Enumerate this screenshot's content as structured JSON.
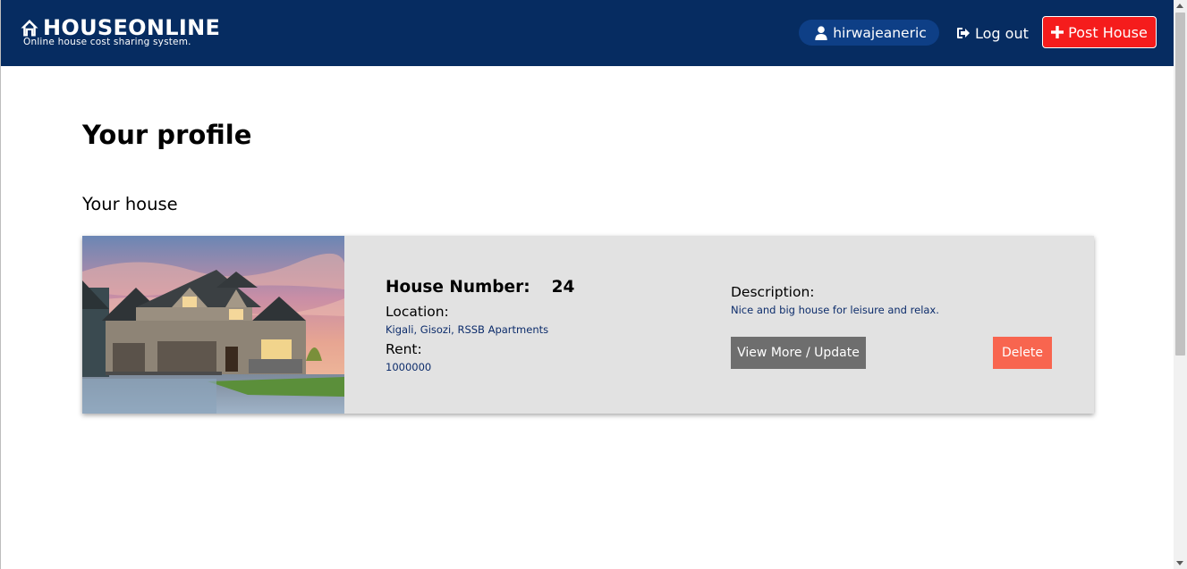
{
  "header": {
    "brand_name": "HOUSEONLINE",
    "brand_tagline": "Online house cost sharing system.",
    "username": "hirwajeaneric",
    "logout_label": "Log out",
    "post_label": "Post House",
    "icons": {
      "brand": "house-icon",
      "user": "user-icon",
      "logout": "sign-out-icon",
      "post": "plus-icon"
    }
  },
  "colors": {
    "header_bg": "#062c61",
    "user_pill_bg": "#0e3f86",
    "post_button": "#f51c1c",
    "card_bg": "#e2e2e2",
    "view_button": "#6e6e6e",
    "delete_button": "#f8654f",
    "value_text": "#0c2c6b"
  },
  "main": {
    "page_title": "Your profile",
    "section_title": "Your house",
    "house": {
      "number_label": "House Number:",
      "number_value": "24",
      "location_label": "Location:",
      "location_value": "Kigali, Gisozi, RSSB Apartments",
      "rent_label": "Rent:",
      "rent_value": "1000000",
      "description_label": "Description:",
      "description_value": "Nice and big house for leisure and relax.",
      "view_label": "View More / Update",
      "delete_label": "Delete"
    }
  }
}
